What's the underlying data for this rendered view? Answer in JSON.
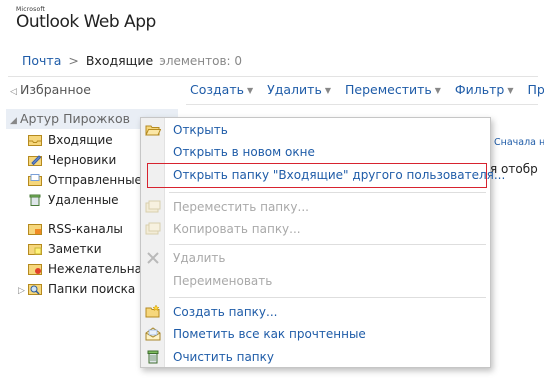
{
  "brand": {
    "company": "Microsoft",
    "app": "Outlook Web App"
  },
  "breadcrumb": {
    "root": "Почта",
    "separator": ">",
    "current": "Входящие",
    "count": "элементов: 0"
  },
  "nav": {
    "favorites": "Избранное",
    "user": "Артур Пирожков",
    "folders": [
      {
        "label": "Входящие",
        "icon": "inbox-icon"
      },
      {
        "label": "Черновики",
        "icon": "drafts-icon"
      },
      {
        "label": "Отправленные",
        "icon": "sent-icon"
      },
      {
        "label": "Удаленные",
        "icon": "deleted-icon"
      },
      {
        "label": "RSS-каналы",
        "icon": "rss-folder-icon"
      },
      {
        "label": "Заметки",
        "icon": "notes-icon"
      },
      {
        "label": "Нежелательная",
        "icon": "junk-icon"
      },
      {
        "label": "Папки поиска",
        "icon": "search-folders-icon"
      }
    ]
  },
  "toolbar": {
    "create": "Создать",
    "delete": "Удалить",
    "move": "Переместить",
    "filter": "Фильтр",
    "view": "Просм"
  },
  "list": {
    "sort_label": "Сначала н",
    "empty_text": "я отобр"
  },
  "menu": {
    "open": "Открыть",
    "open_new_window": "Открыть в новом окне",
    "open_other_inbox": "Открыть папку \"Входящие\" другого пользователя...",
    "move_folder": "Переместить папку...",
    "copy_folder": "Копировать папку...",
    "delete": "Удалить",
    "rename": "Переименовать",
    "create_folder": "Создать папку...",
    "mark_all_read": "Пометить все как прочтенные",
    "empty_folder": "Очистить папку"
  },
  "colors": {
    "link": "#1f5ca8",
    "highlight_border": "#d7232f",
    "selected_bg": "#e9eef5"
  }
}
